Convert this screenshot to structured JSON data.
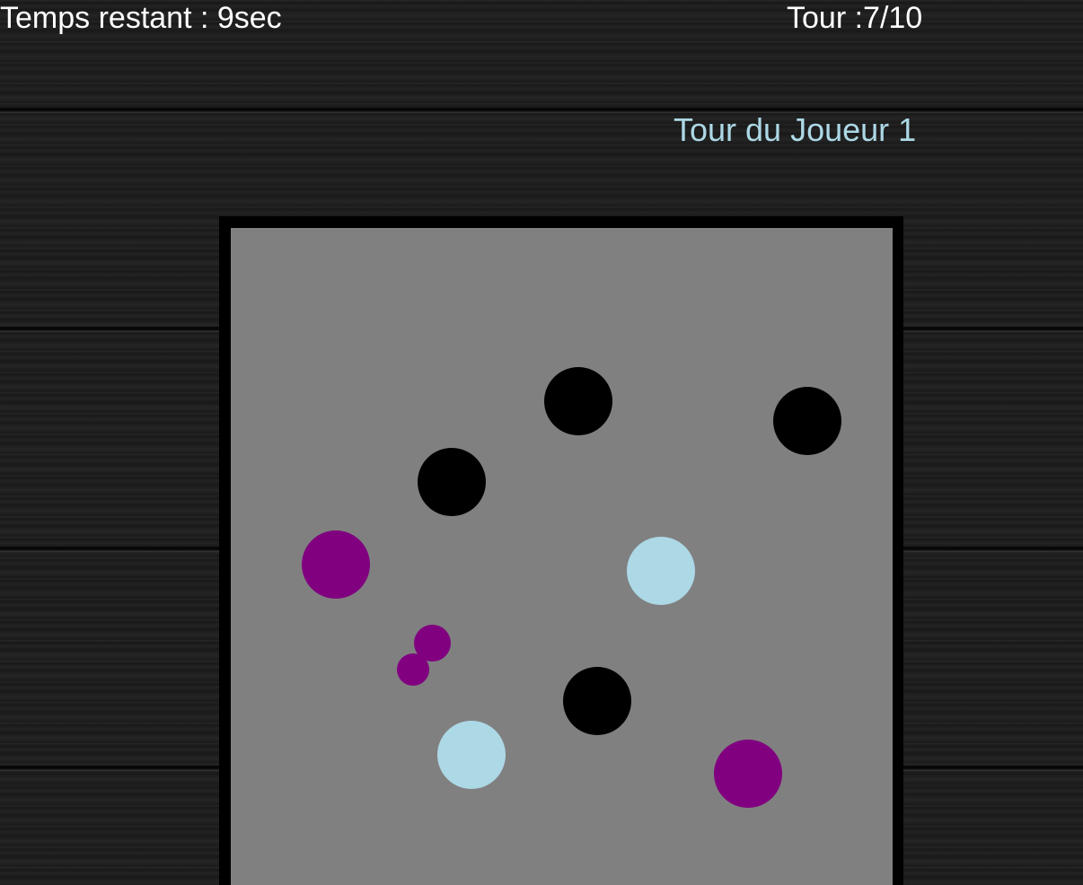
{
  "hud": {
    "timer_text": "Temps restant : 9sec",
    "round_text": "Tour :7/10",
    "turn_text": "Tour du Joueur 1"
  },
  "colors": {
    "black_ball": "#000000",
    "player1_ball": "#add8e6",
    "player2_ball": "#800080",
    "board_surface": "#808080",
    "board_frame": "#000000"
  },
  "balls": [
    {
      "kind": "obstacle",
      "color": "black"
    },
    {
      "kind": "obstacle",
      "color": "black"
    },
    {
      "kind": "obstacle",
      "color": "black"
    },
    {
      "kind": "obstacle",
      "color": "black"
    },
    {
      "kind": "player1",
      "color": "light-blue"
    },
    {
      "kind": "player1",
      "color": "light-blue"
    },
    {
      "kind": "player2",
      "color": "purple"
    },
    {
      "kind": "player2",
      "color": "purple"
    },
    {
      "kind": "player2-small",
      "color": "purple"
    },
    {
      "kind": "player2-small",
      "color": "purple"
    }
  ]
}
